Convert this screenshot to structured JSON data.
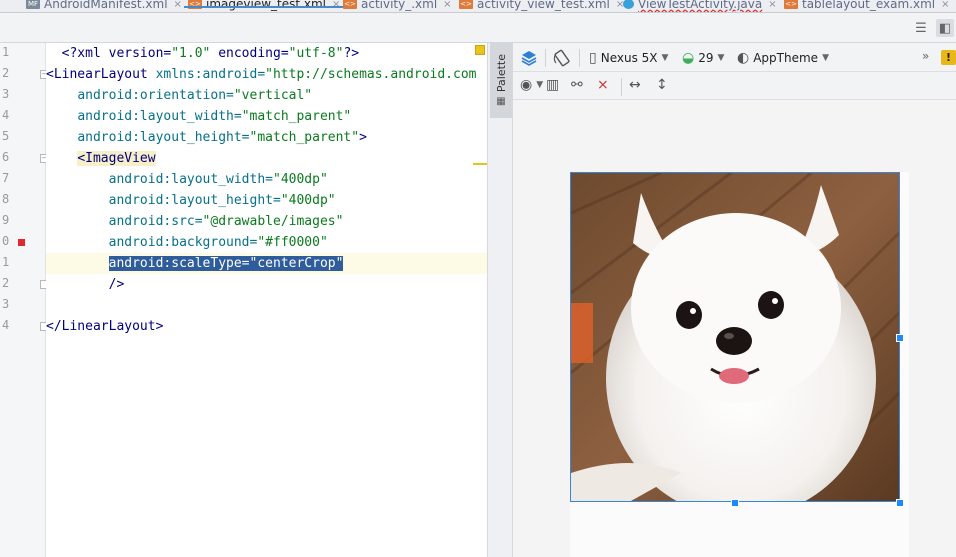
{
  "tabs": [
    {
      "label": "AndroidManifest.xml",
      "icon": "manifest-file-icon",
      "active": false
    },
    {
      "label": "imageview_test.xml",
      "icon": "xml-file-icon",
      "active": true
    },
    {
      "label": "activity_.xml",
      "icon": "xml-file-icon",
      "active": false
    },
    {
      "label": "activity_view_test.xml",
      "icon": "xml-file-icon",
      "active": false
    },
    {
      "label": "ViewTestActivity.java",
      "icon": "java-class-icon",
      "active": false
    },
    {
      "label": "tablelayout_exam.xml",
      "icon": "xml-file-icon",
      "active": false
    }
  ],
  "tab_icon_text": {
    "manifest": "MF",
    "xml": "<>"
  },
  "line_numbers": [
    "1",
    "2",
    "3",
    "4",
    "5",
    "6",
    "7",
    "8",
    "9",
    "0",
    "1",
    "2",
    "3",
    "4"
  ],
  "code": {
    "l1_a": "<?xml version=",
    "l1_b": "\"1.0\"",
    "l1_c": " encoding=",
    "l1_d": "\"utf-8\"",
    "l1_e": "?>",
    "l2_a": "<LinearLayout ",
    "l2_b": "xmlns:android=",
    "l2_c": "\"http://schemas.android.com",
    "l3_a": "android:orientation=",
    "l3_b": "\"vertical\"",
    "l4_a": "android:layout_width=",
    "l4_b": "\"match_parent\"",
    "l5_a": "android:layout_height=",
    "l5_b": "\"match_parent\"",
    "l5_c": ">",
    "l6_a": "<",
    "l6_b": "ImageView",
    "l7_a": "android:layout_width=",
    "l7_b": "\"400dp\"",
    "l8_a": "android:layout_height=",
    "l8_b": "\"400dp\"",
    "l9_a": "android:src=",
    "l9_b": "\"@drawable/images\"",
    "l10_a": "android:background=",
    "l10_b": "\"#ff0000\"",
    "l11_a": "android:scaleType=",
    "l11_b": "\"centerCrop\"",
    "l12_a": "/>",
    "l14_a": "</LinearLayout>"
  },
  "palette": {
    "label": "Palette"
  },
  "design_toolbar": {
    "device": "Nexus 5X",
    "api_level": "29",
    "theme": "AppTheme",
    "overflow": "»",
    "warning_badge": "!"
  },
  "colors": {
    "accent": "#3a86d6",
    "selection": "#1e88ff",
    "error_marker": "#e0282e",
    "warning": "#e9c41a"
  },
  "image": {
    "subject": "white pomeranian dog on wooden floor"
  }
}
